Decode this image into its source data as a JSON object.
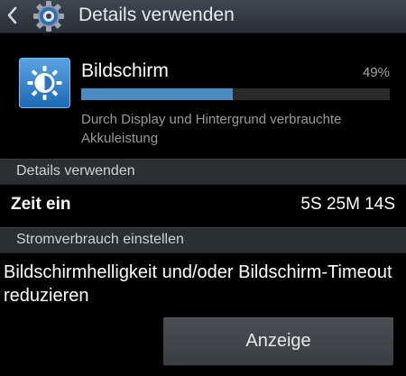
{
  "action_bar": {
    "title": "Details verwenden",
    "back_icon": "chevron-left-icon",
    "app_icon": "gear-icon"
  },
  "usage_item": {
    "name": "Bildschirm",
    "percent_label": "49%",
    "fraction": 0.49,
    "description": "Durch Display und Hintergrund verbrauchte Akkuleistung",
    "icon": "brightness-icon",
    "accent_color": "#4b8cc2"
  },
  "details_section": {
    "header": "Details verwenden",
    "time_label": "Zeit ein",
    "time_value": "5S 25M 14S"
  },
  "power_section": {
    "header": "Stromverbrauch einstellen",
    "tip": "Bildschirmhelligkeit und/oder Bildschirm-Timeout reduzieren",
    "button_label": "Anzeige"
  }
}
